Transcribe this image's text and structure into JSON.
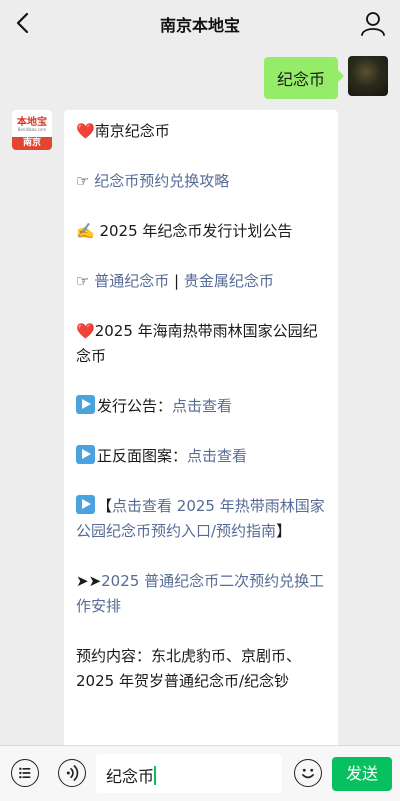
{
  "header": {
    "title": "南京本地宝"
  },
  "outgoing": {
    "text": "纪念币"
  },
  "bot_avatar": {
    "logo_text": "本地宝",
    "logo_url": "Bendibao.com",
    "city": "南京"
  },
  "message": {
    "heading": "南京纪念币",
    "guide_link": "纪念币预约兑换攻略",
    "plan_text": "2025 年纪念币发行计划公告",
    "normal_link": "普通纪念币",
    "separator": "|",
    "precious_link": "贵金属纪念币",
    "rainforest_title": "2025 年海南热带雨林国家公园纪念币",
    "notice_label": "发行公告：",
    "notice_link": "点击查看",
    "design_label": "正反面图案：",
    "design_link": "点击查看",
    "bracket_open": "【",
    "reserve_link": "点击查看 2025 年热带雨林国家公园纪念币预约入口/预约指南",
    "bracket_close": "】",
    "arrows": "➤➤",
    "second_link": "2025 普通纪念币二次预约兑换工作安排",
    "content_text": "预约内容：东北虎豹币、京剧币、2025 年贺岁普通纪念币/纪念钞"
  },
  "input": {
    "value": "纪念币"
  },
  "send": {
    "label": "发送"
  },
  "icons": {
    "back": "chevron-left-icon",
    "profile": "person-icon",
    "menu": "list-icon",
    "voice": "voice-icon",
    "emoji": "smile-icon",
    "heart": "heart-icon",
    "pointer": "pointing-hand-icon",
    "writing": "writing-hand-icon",
    "play": "play-button-icon"
  },
  "colors": {
    "bubble_out": "#95ec69",
    "link": "#576b95",
    "send": "#07c160",
    "background": "#ededed"
  }
}
